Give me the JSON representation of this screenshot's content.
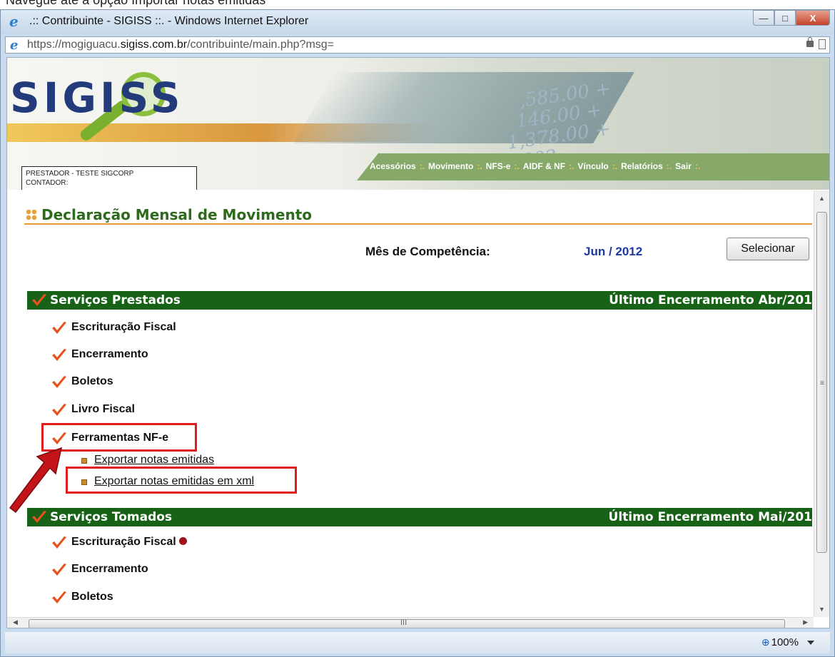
{
  "caption": "Navegue até a opção Importar notas emitidas",
  "window": {
    "title": ".:: Contribuinte - SIGISS ::. - Windows Internet Explorer",
    "url_prefix": "https://mogiguacu.",
    "url_domain": "sigiss.com.br",
    "url_suffix": "/contribuinte/main.php?msg=",
    "btn_min": "—",
    "btn_max": "□",
    "btn_close": "X"
  },
  "header": {
    "logo": "SIGISS",
    "user_line1": "PRESTADOR - TESTE SIGCORP",
    "user_line2": "CONTADOR:",
    "menu": [
      "Acessórios",
      "Movimento",
      "NFS-e",
      "AIDF & NF",
      "Vínculo",
      "Relatórios",
      "Sair"
    ],
    "menu_sep": ":.",
    "numbers": "    ,585.00 +\n   146.00 +\n 1,378.00 +\n1,002.  "
  },
  "page": {
    "title": "Declaração Mensal de Movimento",
    "competencia_label": "Mês de Competência:",
    "competencia_value": "Jun / 2012",
    "select_button": "Selecionar"
  },
  "servicos_prestados": {
    "title": "Serviços Prestados",
    "ultimo": "Último Encerramento Abr/201",
    "items": [
      "Escrituração Fiscal",
      "Encerramento",
      "Boletos",
      "Livro Fiscal",
      "Ferramentas NF-e"
    ],
    "sub_items": [
      "Exportar notas emitidas",
      "Exportar notas emitidas em xml"
    ]
  },
  "servicos_tomados": {
    "title": "Serviços Tomados",
    "ultimo": "Último Encerramento Mai/201",
    "items": [
      "Escrituração Fiscal",
      "Encerramento",
      "Boletos"
    ]
  },
  "status": {
    "zoom": "100%"
  },
  "colors": {
    "section_green": "#176217",
    "title_green": "#2e6a1e",
    "check_orange": "#e8521a",
    "highlight_red": "#e11c1c",
    "menu_green": "#86a96a"
  }
}
